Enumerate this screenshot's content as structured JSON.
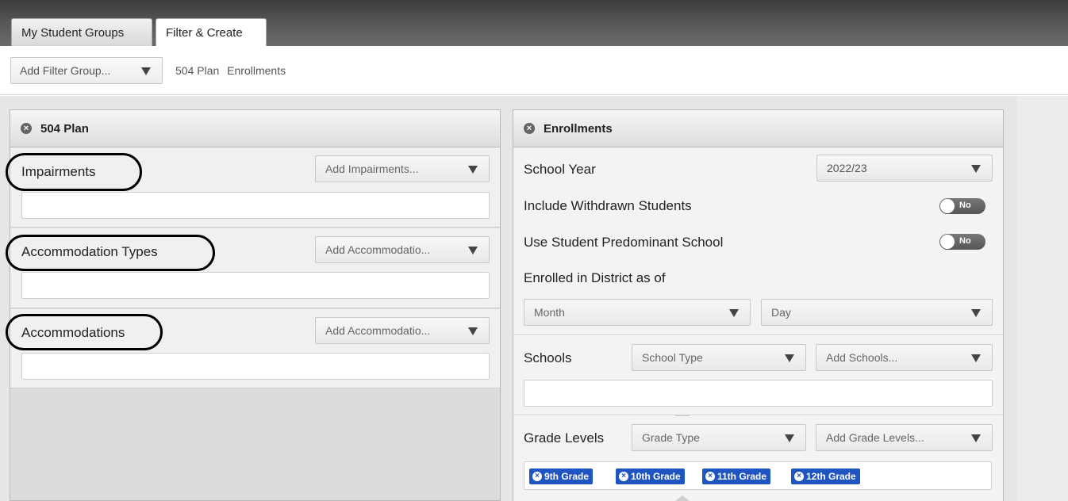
{
  "tabs": [
    {
      "label": "My Student Groups"
    },
    {
      "label": "Filter & Create"
    }
  ],
  "toolbar": {
    "add_filter_label": "Add Filter Group...",
    "crumbs": [
      "504 Plan",
      "Enrollments"
    ]
  },
  "plan504": {
    "title": "504 Plan",
    "sections": [
      {
        "label": "Impairments",
        "dropdown": "Add Impairments..."
      },
      {
        "label": "Accommodation Types",
        "dropdown": "Add Accommodatio..."
      },
      {
        "label": "Accommodations",
        "dropdown": "Add Accommodatio..."
      }
    ]
  },
  "enrollments": {
    "title": "Enrollments",
    "school_year_label": "School Year",
    "school_year_value": "2022/23",
    "include_withdrawn_label": "Include Withdrawn Students",
    "include_withdrawn_value": "No",
    "predominant_label": "Use Student Predominant School",
    "predominant_value": "No",
    "enrolled_as_of_label": "Enrolled in District as of",
    "month_placeholder": "Month",
    "day_placeholder": "Day",
    "schools_label": "Schools",
    "school_type_placeholder": "School Type",
    "add_schools_placeholder": "Add Schools...",
    "grade_levels_label": "Grade Levels",
    "grade_type_placeholder": "Grade Type",
    "add_grade_levels_placeholder": "Add Grade Levels...",
    "grade_chips": [
      "9th Grade",
      "10th Grade",
      "11th Grade",
      "12th Grade"
    ]
  },
  "colors": {
    "chip_blue": "#1f55c2",
    "topbar": "#4a4a4a"
  }
}
